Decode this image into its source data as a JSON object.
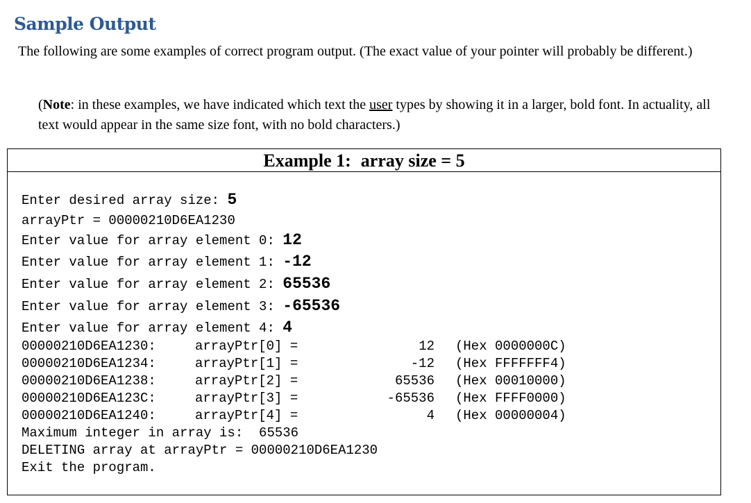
{
  "heading": "Sample Output",
  "intro": "The following are some examples of correct program output. (The exact value of your pointer will probably be different.)",
  "note": {
    "open": "(",
    "bold": "Note",
    "before_user": ":  in these examples, we have indicated which text the ",
    "user_word": "user",
    "after_user": " types by showing it in a larger, bold font.  In actuality, all text would appear in the same size font, with no bold characters.)"
  },
  "example": {
    "title_left": "Example 1:",
    "title_right": "array size = 5"
  },
  "console": {
    "prompts": [
      {
        "text": "Enter desired array size: ",
        "input": "5"
      },
      {
        "text": "arrayPtr = 00000210D6EA1230",
        "input": ""
      },
      {
        "text": "Enter value for array element 0: ",
        "input": "12"
      },
      {
        "text": "Enter value for array element 1: ",
        "input": "-12"
      },
      {
        "text": "Enter value for array element 2: ",
        "input": "65536"
      },
      {
        "text": "Enter value for array element 3: ",
        "input": "-65536"
      },
      {
        "text": "Enter value for array element 4: ",
        "input": "4"
      }
    ],
    "rows": [
      {
        "addr": "00000210D6EA1230:",
        "name": "arrayPtr[0] =",
        "value": "12",
        "hex": "(Hex 0000000C)"
      },
      {
        "addr": "00000210D6EA1234:",
        "name": "arrayPtr[1] =",
        "value": "-12",
        "hex": "(Hex FFFFFFF4)"
      },
      {
        "addr": "00000210D6EA1238:",
        "name": "arrayPtr[2] =",
        "value": "65536",
        "hex": "(Hex 00010000)"
      },
      {
        "addr": "00000210D6EA123C:",
        "name": "arrayPtr[3] =",
        "value": "-65536",
        "hex": "(Hex FFFF0000)"
      },
      {
        "addr": "00000210D6EA1240:",
        "name": "arrayPtr[4] =",
        "value": "4",
        "hex": "(Hex 00000004)"
      }
    ],
    "max_line": "Maximum integer in array is:  65536",
    "delete_line": "DELETING array at arrayPtr = 00000210D6EA1230",
    "exit_line": "Exit the program."
  }
}
